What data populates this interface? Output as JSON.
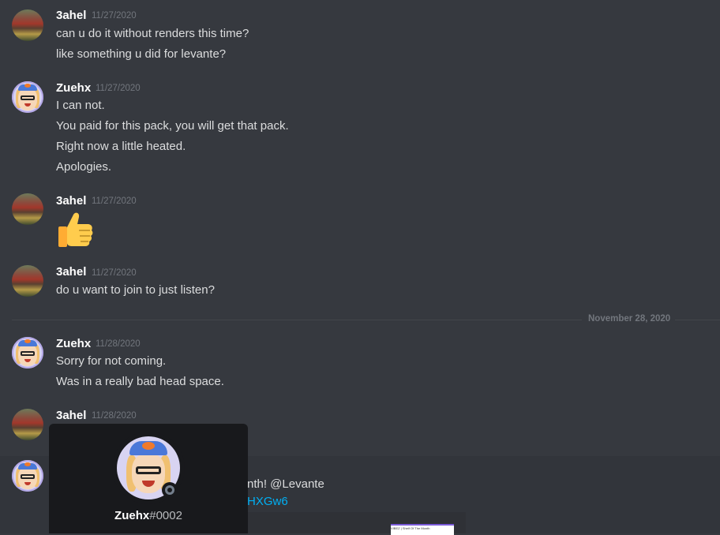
{
  "messages": [
    {
      "author": "3ahel",
      "timestamp": "11/27/2020",
      "lines": [
        "can u do it without renders this time?",
        "like something u did for levante?"
      ]
    },
    {
      "author": "Zuehx",
      "timestamp": "11/27/2020",
      "lines": [
        "I can not.",
        "You paid for this pack, you will get that pack.",
        "Right now a little heated.",
        "Apologies."
      ]
    },
    {
      "author": "3ahel",
      "timestamp": "11/27/2020",
      "emoji": "thumbs-up"
    },
    {
      "author": "3ahel",
      "timestamp": "11/27/2020",
      "lines": [
        "do u want to join to just listen?"
      ]
    },
    {
      "author": "Zuehx",
      "timestamp": "11/28/2020",
      "lines": [
        "Sorry for not coming.",
        "Was in a really bad head space."
      ]
    },
    {
      "author": "3ahel",
      "timestamp": "11/28/2020"
    },
    {
      "author": "Zuehx",
      "partial_lines": [
        "nth! @Levante",
        "HXGw6"
      ]
    }
  ],
  "date_divider": "November 28, 2020",
  "profile_popout": {
    "username": "Zuehx",
    "discriminator": "#0002",
    "status": "offline"
  },
  "embed": {
    "thumb_text": "VIBEZ | Shelf Of The Month"
  },
  "colors": {
    "background": "#36393f",
    "username": "#ffffff",
    "timestamp": "#72767d",
    "link": "#00b0f4",
    "popout": "#18191c"
  }
}
